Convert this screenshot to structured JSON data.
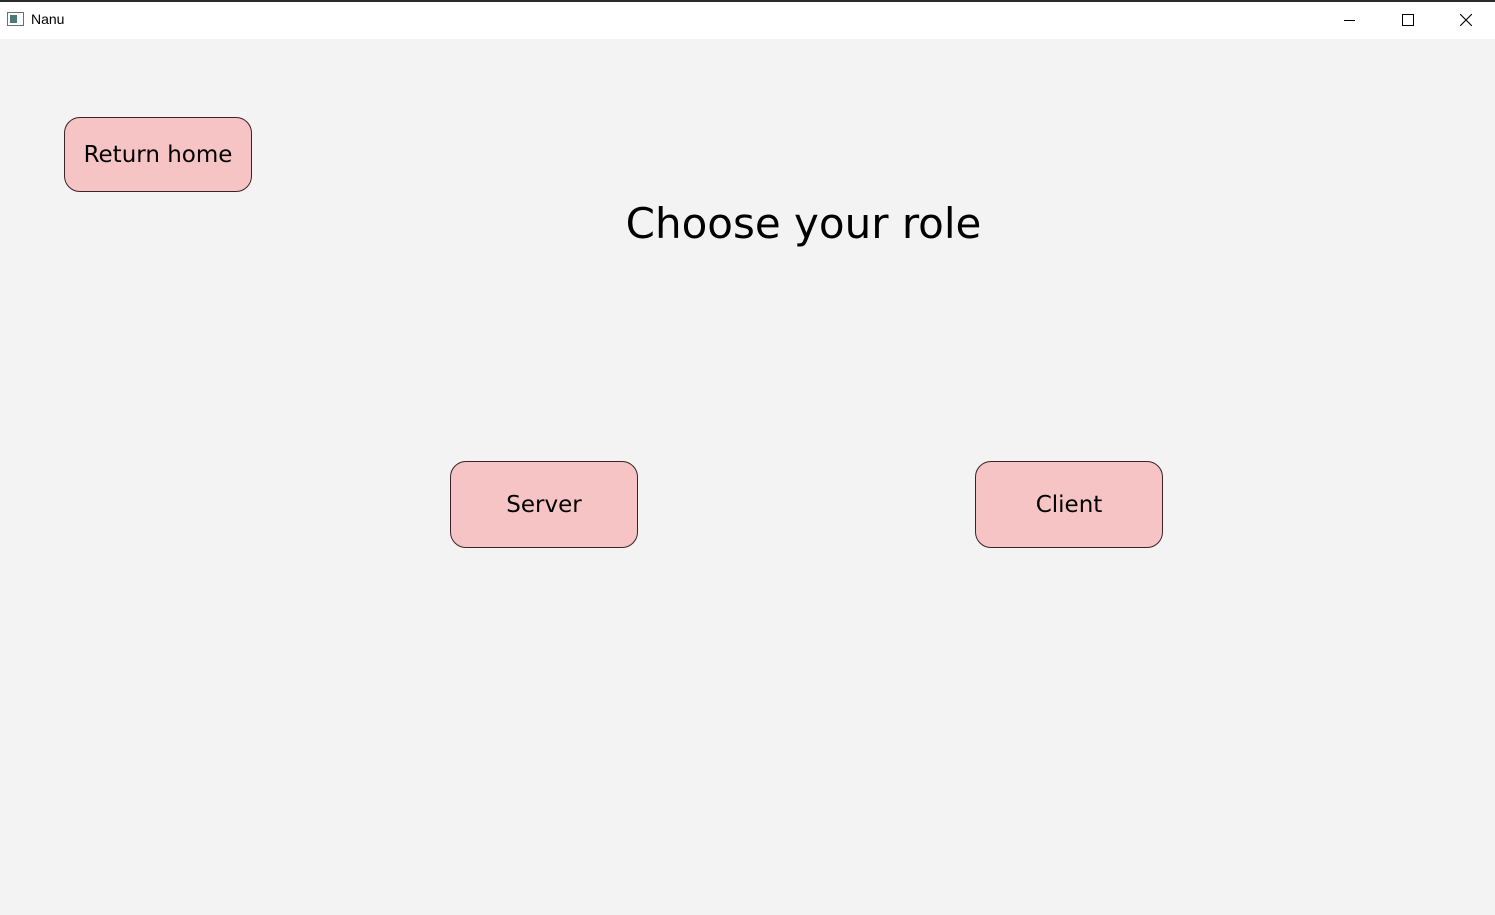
{
  "window": {
    "title": "Nanu",
    "icon": "app-window-icon",
    "controls": [
      "minimize-icon",
      "maximize-icon",
      "close-icon"
    ]
  },
  "main": {
    "heading": "Choose your role",
    "return_home_label": "Return home",
    "server_label": "Server",
    "client_label": "Client"
  },
  "colors": {
    "background": "#f3f3f3",
    "button_fill": "#f6c4c4",
    "button_border": "#3a2226"
  }
}
